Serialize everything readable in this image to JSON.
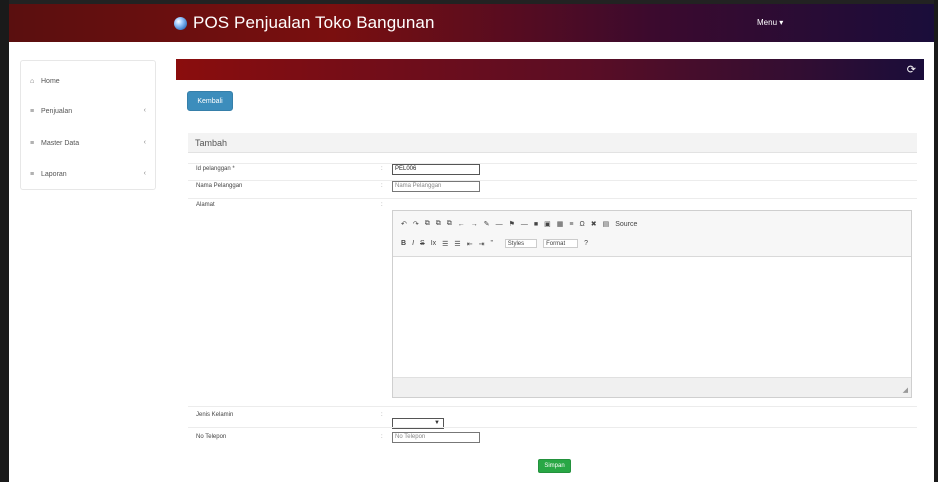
{
  "navbar": {
    "app_title": "POS Penjualan Toko Bangunan",
    "menu_label": "Menu ▾"
  },
  "sidebar": {
    "items": [
      {
        "label": "Home",
        "icon": "home-icon",
        "expandable": false
      },
      {
        "label": "Penjualan",
        "icon": "list-icon",
        "expandable": true
      },
      {
        "label": "Master Data",
        "icon": "list-icon",
        "expandable": true
      },
      {
        "label": "Laporan",
        "icon": "list-icon",
        "expandable": true
      }
    ]
  },
  "actions": {
    "back_label": "Kembali",
    "save_label": "Simpan"
  },
  "form": {
    "title": "Tambah",
    "fields": {
      "id_pelanggan": {
        "label": "Id pelanggan *",
        "value": "PEL006"
      },
      "nama": {
        "label": "Nama Pelanggan",
        "placeholder": "Nama Pelanggan"
      },
      "alamat": {
        "label": "Alamat"
      },
      "jenis_kelamin": {
        "label": "Jenis Kelamin",
        "value": ""
      },
      "no_telepon": {
        "label": "No Telepon",
        "placeholder": "No Telepon"
      }
    },
    "colon": ":"
  },
  "editor": {
    "toolbar_row1": [
      "↶",
      "↷",
      "⧉",
      "⧉",
      "⧉",
      "←",
      "→",
      "✎",
      "—",
      "⚑",
      "—",
      "■",
      "▣",
      "▦",
      "≡",
      "Ω",
      "✖",
      "▤",
      "Source"
    ],
    "toolbar_row2": [
      "B",
      "I",
      "S",
      "Ix",
      "☰",
      "☰",
      "⇤",
      "⇥",
      "”"
    ],
    "styles_label": "Styles",
    "format_label": "Format",
    "help_label": "?"
  },
  "colors": {
    "nav_start": "#5a0f0f",
    "nav_end": "#1a0d3a",
    "back_button": "#3c8dbc",
    "save_button": "#28a745"
  }
}
